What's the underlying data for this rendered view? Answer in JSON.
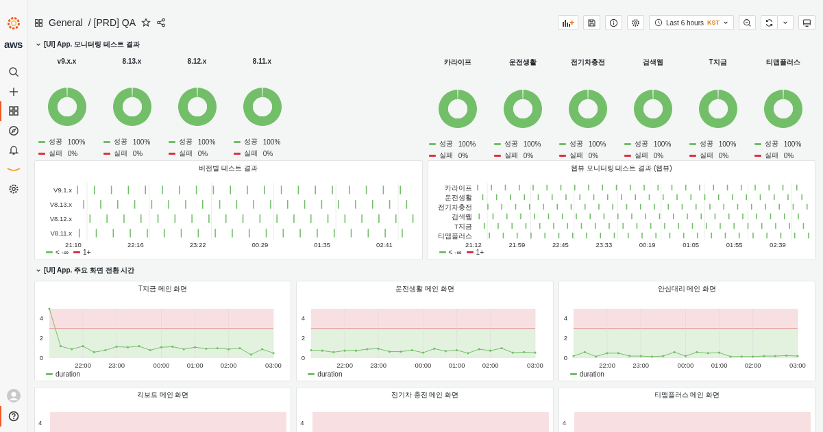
{
  "sidebar": {
    "logo_text": "aws",
    "items": [
      {
        "kind": "search",
        "selected": false
      },
      {
        "kind": "plus",
        "selected": false
      },
      {
        "kind": "dashboards",
        "selected": true
      },
      {
        "kind": "compass",
        "selected": false
      },
      {
        "kind": "bell",
        "selected": false
      },
      {
        "kind": "smile",
        "selected": false
      },
      {
        "kind": "gear",
        "selected": false
      }
    ],
    "bottom_items": [
      {
        "kind": "avatar",
        "selected": false
      },
      {
        "kind": "help",
        "selected": true
      }
    ]
  },
  "header": {
    "folder": "General",
    "title": "/ [PRD] QA",
    "time_range": "Last 6 hours",
    "timezone": "KST"
  },
  "sections": [
    {
      "title": "[UI] App. 모니터링 테스트 결과",
      "expanded": true,
      "donut_groups": [
        [
          {
            "title": "v9.x.x",
            "legend": [
              {
                "value": "100%",
                "color": "#73bf69"
              },
              {
                "value": "0%",
                "color": "#e02f44"
              }
            ],
            "chart_data": {
              "type": "donut",
              "categories": [
                "성공",
                "실패"
              ],
              "values": [
                100,
                0
              ]
            }
          },
          {
            "title": "8.13.x",
            "legend": [
              {
                "value": "100%",
                "color": "#73bf69"
              },
              {
                "value": "0%",
                "color": "#e02f44"
              }
            ],
            "chart_data": {
              "type": "donut",
              "categories": [
                "성공",
                "실패"
              ],
              "values": [
                100,
                0
              ]
            }
          },
          {
            "title": "8.12.x",
            "legend": [
              {
                "value": "100%",
                "color": "#73bf69"
              },
              {
                "value": "0%",
                "color": "#e02f44"
              }
            ],
            "chart_data": {
              "type": "donut",
              "categories": [
                "성공",
                "실패"
              ],
              "values": [
                100,
                0
              ]
            }
          },
          {
            "title": "8.11.x",
            "legend": [
              {
                "value": "100%",
                "color": "#73bf69"
              },
              {
                "value": "0%",
                "color": "#e02f44"
              }
            ],
            "chart_data": {
              "type": "donut",
              "categories": [
                "성공",
                "실패"
              ],
              "values": [
                100,
                0
              ]
            }
          }
        ],
        [
          {
            "title": "카라이프",
            "legend": [
              {
                "value": "100%",
                "color": "#73bf69"
              },
              {
                "value": "0%",
                "color": "#e02f44"
              }
            ],
            "chart_data": {
              "type": "donut",
              "categories": [
                "성공",
                "실패"
              ],
              "values": [
                100,
                0
              ]
            }
          },
          {
            "title": "운전생활",
            "legend": [
              {
                "value": "100%",
                "color": "#73bf69"
              },
              {
                "value": "0%",
                "color": "#e02f44"
              }
            ],
            "chart_data": {
              "type": "donut",
              "categories": [
                "성공",
                "실패"
              ],
              "values": [
                100,
                0
              ]
            }
          },
          {
            "title": "전기차충전",
            "legend": [
              {
                "value": "100%",
                "color": "#73bf69"
              },
              {
                "value": "0%",
                "color": "#e02f44"
              }
            ],
            "chart_data": {
              "type": "donut",
              "categories": [
                "성공",
                "실패"
              ],
              "values": [
                100,
                0
              ]
            }
          },
          {
            "title": "검색웹",
            "legend": [
              {
                "value": "100%",
                "color": "#73bf69"
              },
              {
                "value": "0%",
                "color": "#e02f44"
              }
            ],
            "chart_data": {
              "type": "donut",
              "categories": [
                "성공",
                "실패"
              ],
              "values": [
                100,
                0
              ]
            }
          },
          {
            "title": "T지금",
            "legend": [
              {
                "value": "100%",
                "color": "#73bf69"
              },
              {
                "value": "0%",
                "color": "#e02f44"
              }
            ],
            "chart_data": {
              "type": "donut",
              "categories": [
                "성공",
                "실패"
              ],
              "values": [
                100,
                0
              ]
            }
          },
          {
            "title": "티맵플러스",
            "legend": [
              {
                "value": "100%",
                "color": "#73bf69"
              },
              {
                "value": "0%",
                "color": "#e02f44"
              }
            ],
            "chart_data": {
              "type": "donut",
              "categories": [
                "성공",
                "실패"
              ],
              "values": [
                100,
                0
              ]
            }
          }
        ]
      ],
      "timelines": [
        {
          "title": "버전별 테스트 결과",
          "rows": [
            "V9.1.x",
            "V8.13.x",
            "V8.12.x",
            "V8.11.x"
          ],
          "xticks": [
            "21:10",
            "22:16",
            "23:22",
            "00:29",
            "01:35",
            "02:41"
          ],
          "legend": [
            {
              "label": "< -∞",
              "color": "#73bf69"
            },
            {
              "label": "1+",
              "color": "#e02f44"
            }
          ]
        },
        {
          "title": "웹뷰 모니터링 테스트 결과 (웹뷰)",
          "rows": [
            "카라이프",
            "운전생활",
            "전기차충전",
            "검색웹",
            "T지금",
            "티맵플러스"
          ],
          "xticks": [
            "21:12",
            "21:59",
            "22:45",
            "23:33",
            "00:19",
            "01:05",
            "01:55",
            "02:39"
          ],
          "legend": [
            {
              "label": "< -∞",
              "color": "#73bf69"
            },
            {
              "label": "1+",
              "color": "#e02f44"
            }
          ]
        }
      ]
    },
    {
      "title": "[UI] App. 주요 화면 전환 시간",
      "expanded": true,
      "line_panels": [
        {
          "title": "T지금 메인 화면",
          "chart_data": {
            "type": "line",
            "categories": [
              null,
              null,
              null,
              "22:00",
              null,
              null,
              "23:00",
              null,
              null,
              null,
              "00:00",
              null,
              null,
              "01:00",
              null,
              null,
              "02:00",
              null,
              null,
              null,
              "03:00"
            ],
            "series": [
              {
                "name": "duration",
                "color": "#73bf69",
                "values": [
                  5,
                  1.2,
                  0.9,
                  1.2,
                  0.6,
                  0.8,
                  1.15,
                  1.1,
                  1.2,
                  0.8,
                  1.1,
                  1.15,
                  0.9,
                  1.1,
                  0.95,
                  1.0,
                  0.9,
                  1.0,
                  0.35,
                  0.9,
                  0.5
                ]
              }
            ],
            "ylim": [
              0,
              5
            ],
            "yticks": [
              0,
              2,
              4
            ],
            "grid": true
          }
        },
        {
          "title": "운전생활 메인 화면",
          "chart_data": {
            "type": "line",
            "categories": [
              null,
              null,
              null,
              "22:00",
              null,
              null,
              "23:00",
              null,
              null,
              null,
              "00:00",
              null,
              null,
              "01:00",
              null,
              null,
              "02:00",
              null,
              null,
              null,
              "03:00"
            ],
            "series": [
              {
                "name": "duration",
                "color": "#73bf69",
                "values": [
                  0.8,
                  0.75,
                  0.6,
                  0.75,
                  0.75,
                  0.9,
                  0.95,
                  0.65,
                  0.65,
                  0.8,
                  0.55,
                  0.95,
                  0.7,
                  0.8,
                  0.5,
                  0.9,
                  0.75,
                  1.0,
                  0.55,
                  0.6,
                  0.55
                ]
              }
            ],
            "ylim": [
              0,
              5
            ],
            "yticks": [
              0,
              2,
              4
            ],
            "grid": true
          }
        },
        {
          "title": "안심대리 메인 화면",
          "chart_data": {
            "type": "line",
            "categories": [
              null,
              null,
              null,
              "22:00",
              null,
              null,
              "23:00",
              null,
              null,
              null,
              "00:00",
              null,
              null,
              "01:00",
              null,
              null,
              "02:00",
              null,
              null,
              null,
              "03:00"
            ],
            "series": [
              {
                "name": "duration",
                "color": "#73bf69",
                "values": [
                  0.2,
                  0.6,
                  0.15,
                  0.5,
                  0.5,
                  0.2,
                  0.2,
                  0.15,
                  0.2,
                  0.6,
                  0.2,
                  0.6,
                  0.5,
                  0.55,
                  0.15,
                  0.15,
                  0.15,
                  0.2,
                  0.2,
                  0.25,
                  0.2
                ]
              }
            ],
            "ylim": [
              0,
              5
            ],
            "yticks": [
              0,
              2,
              4
            ],
            "grid": true
          }
        }
      ],
      "cut_panels": [
        {
          "title": "킥보드 메인 화면",
          "y_tick": "4"
        },
        {
          "title": "전기차 충전 메인 화면",
          "y_tick": "4"
        },
        {
          "title": "티맵플러스 메인 화면",
          "y_tick": "4"
        }
      ]
    }
  ]
}
